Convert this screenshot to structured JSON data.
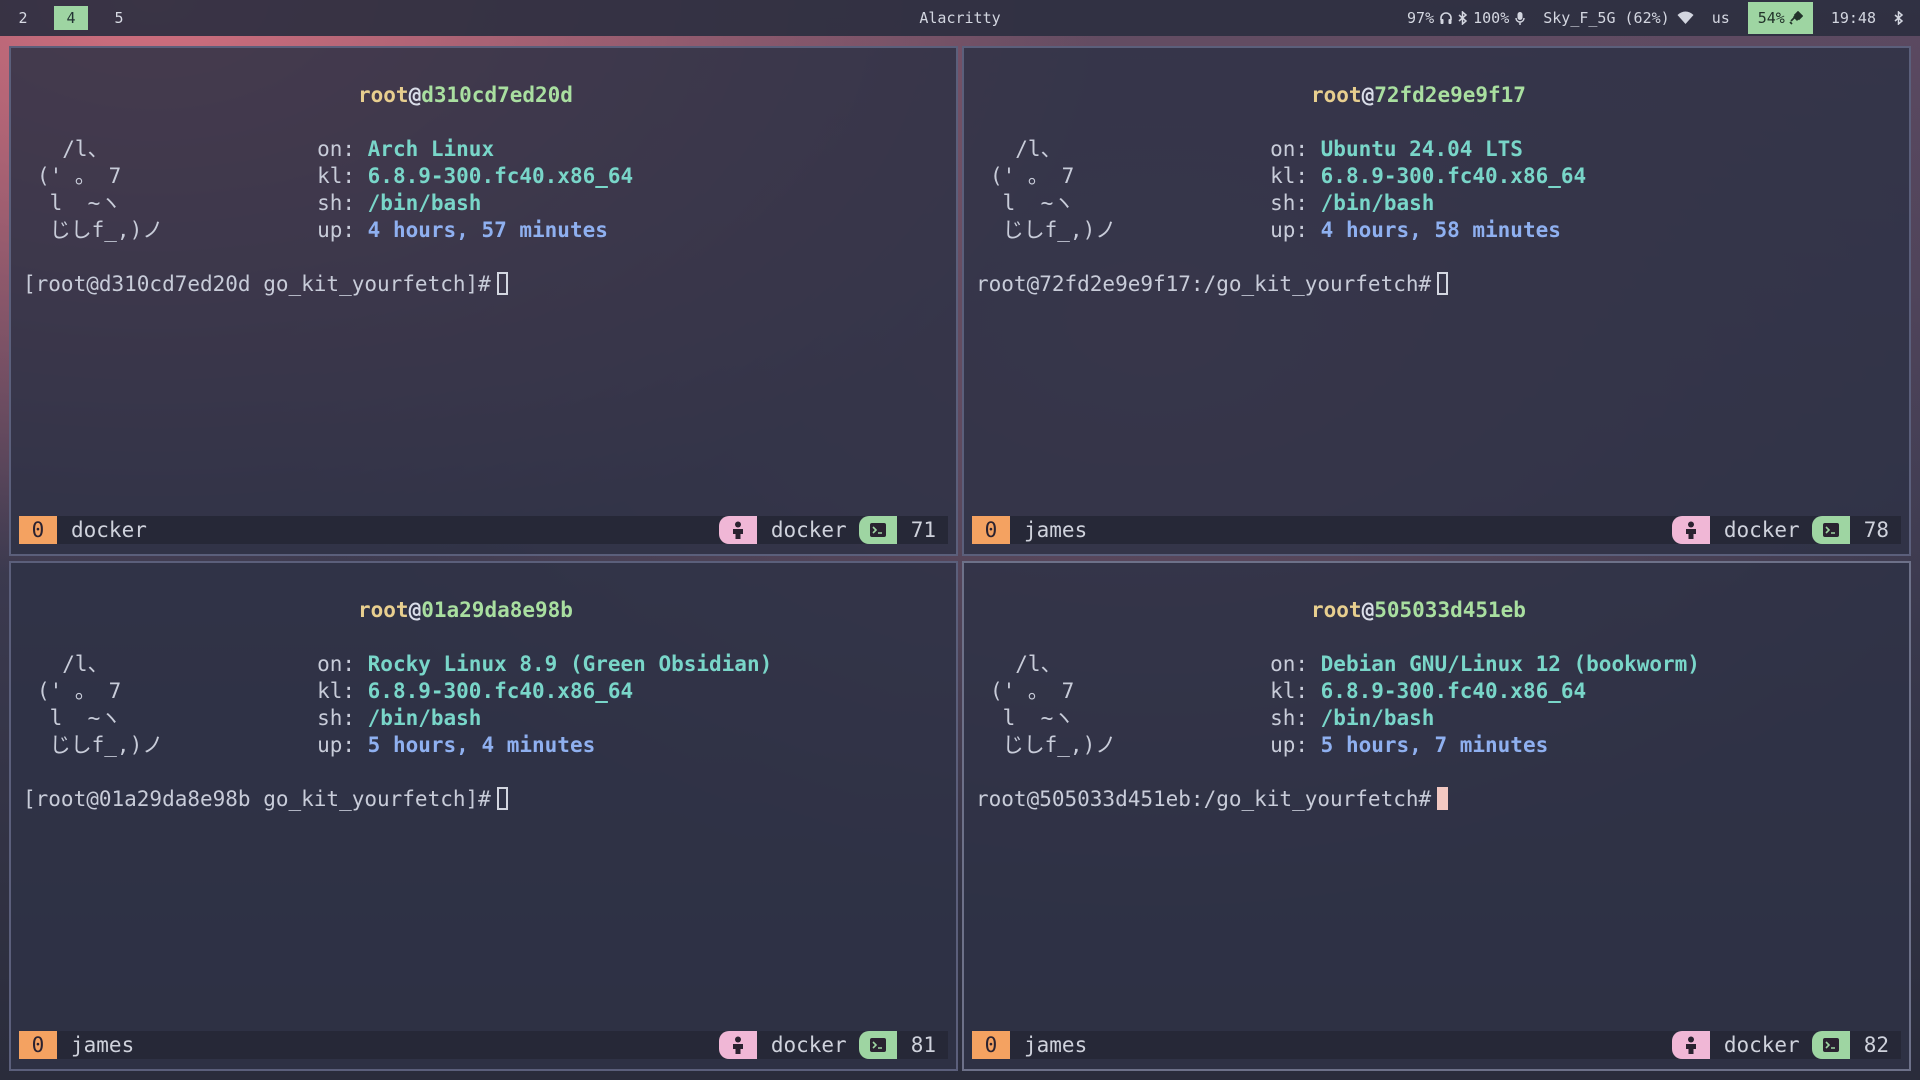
{
  "topbar": {
    "workspaces": [
      {
        "label": "2",
        "active": false
      },
      {
        "label": "4",
        "active": true
      },
      {
        "label": "5",
        "active": false
      }
    ],
    "window_title": "Alacritty",
    "headphones_battery": "97%",
    "bluetooth_battery": "100%",
    "wifi_name": "Sky_F_5G (62%)",
    "keyboard_layout": "us",
    "battery": "54%",
    "clock": "19:48",
    "colors": {
      "accent_green": "#9ed5a2",
      "bar_bg": "#2c2f40"
    }
  },
  "panes": [
    {
      "host_user": "root",
      "host_name": "d310cd7ed20d",
      "art": "  /l、\n(' 。 7\n l  ~ヽ\n じしf_,)ノ",
      "os": "Arch Linux",
      "kernel": "6.8.9-300.fc40.x86_64",
      "shell": "/bin/bash",
      "uptime": "4 hours, 57 minutes",
      "prompt": "[root@d310cd7ed20d go_kit_yourfetch]#",
      "status": {
        "index": "0",
        "window": "docker",
        "session": "docker",
        "number": "71"
      }
    },
    {
      "host_user": "root",
      "host_name": "72fd2e9e9f17",
      "art": "  /l、\n(' 。 7\n l  ~ヽ\n じしf_,)ノ",
      "os": "Ubuntu 24.04 LTS",
      "kernel": "6.8.9-300.fc40.x86_64",
      "shell": "/bin/bash",
      "uptime": "4 hours, 58 minutes",
      "prompt": "root@72fd2e9e9f17:/go_kit_yourfetch#",
      "status": {
        "index": "0",
        "window": "james",
        "session": "docker",
        "number": "78"
      }
    },
    {
      "host_user": "root",
      "host_name": "01a29da8e98b",
      "art": "  /l、\n(' 。 7\n l  ~ヽ\n じしf_,)ノ",
      "os": "Rocky Linux 8.9 (Green Obsidian)",
      "kernel": "6.8.9-300.fc40.x86_64",
      "shell": "/bin/bash",
      "uptime": "5 hours, 4 minutes",
      "prompt": "[root@01a29da8e98b go_kit_yourfetch]#",
      "status": {
        "index": "0",
        "window": "james",
        "session": "docker",
        "number": "81"
      }
    },
    {
      "host_user": "root",
      "host_name": "505033d451eb",
      "art": "  /l、\n(' 。 7\n l  ~ヽ\n じしf_,)ノ",
      "os": "Debian GNU/Linux 12 (bookworm)",
      "kernel": "6.8.9-300.fc40.x86_64",
      "shell": "/bin/bash",
      "uptime": "5 hours, 7 minutes",
      "prompt": "root@505033d451eb:/go_kit_yourfetch#",
      "status": {
        "index": "0",
        "window": "james",
        "session": "docker",
        "number": "82"
      }
    }
  ],
  "info_keys": {
    "os": "on:",
    "kernel": "kl:",
    "shell": "sh:",
    "uptime": "up:"
  },
  "host_at": "@"
}
